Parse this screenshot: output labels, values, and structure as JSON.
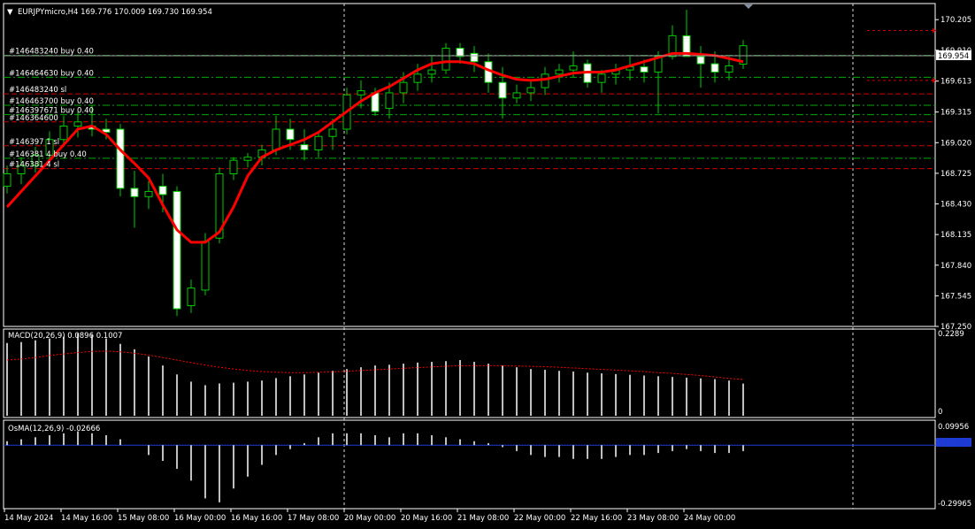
{
  "header": {
    "menu_glyph": "▼",
    "symbol_info": "EURJPYmicro,H4  169.776 170.009 169.730 169.954"
  },
  "colors": {
    "background": "#000000",
    "bull_candle": "#000000",
    "bear_candle": "#ffffff",
    "wick": "#00cc00",
    "ma_line": "#ff0000",
    "grid": "#ffffff",
    "macd_hist": "#c0c0c0",
    "signal": "#ff0000",
    "osma_zero": "#1f3bd6",
    "trade_green": "#00aa00",
    "trade_red": "#cc0000"
  },
  "price_scale": {
    "ticks": [
      "170.205",
      "169.910",
      "169.613",
      "169.315",
      "169.020",
      "168.725",
      "168.430",
      "168.135",
      "167.840",
      "167.545",
      "167.250"
    ],
    "current_price": "169.954"
  },
  "trade_labels": [
    "#146483240 buy 0.40",
    "#146464630 buy 0.40",
    "#146483240 sl",
    "#146463700 buy 0.40",
    "#146397671 buy 0.40",
    "#146364600",
    "#146397   1 sl",
    "#146381   4 buy 0.40",
    "#146381   4 sl"
  ],
  "time_axis": [
    "14 May 2024",
    "14 May 16:00",
    "15 May 08:00",
    "16 May 00:00",
    "16 May 16:00",
    "17 May 08:00",
    "20 May 00:00",
    "20 May 16:00",
    "21 May 08:00",
    "22 May 00:00",
    "22 May 16:00",
    "23 May 08:00",
    "24 May 00:00"
  ],
  "macd": {
    "title": "MACD(20,26,9) 0.0896 0.1007",
    "scale_top": "0.2289",
    "scale_zero": "0"
  },
  "osma": {
    "title": "OsMA(12,26,9) -0.02666",
    "scale_top": "0.09956",
    "scale_bottom": "-0.29965",
    "current": "-0.02666"
  },
  "chart_data": {
    "type": "candlestick",
    "symbol": "EURJPYmicro",
    "timeframe": "H4",
    "ylim": [
      167.25,
      170.36
    ],
    "candles": [
      {
        "o": 168.6,
        "h": 168.8,
        "l": 168.53,
        "c": 168.72
      },
      {
        "o": 168.72,
        "h": 168.88,
        "l": 168.62,
        "c": 168.8
      },
      {
        "o": 168.8,
        "h": 168.98,
        "l": 168.73,
        "c": 168.9
      },
      {
        "o": 168.9,
        "h": 169.13,
        "l": 168.83,
        "c": 169.05
      },
      {
        "o": 169.05,
        "h": 169.28,
        "l": 168.98,
        "c": 169.18
      },
      {
        "o": 169.18,
        "h": 169.32,
        "l": 169.07,
        "c": 169.22
      },
      {
        "o": 169.18,
        "h": 169.38,
        "l": 169.08,
        "c": 169.15
      },
      {
        "o": 169.15,
        "h": 169.25,
        "l": 169.05,
        "c": 169.12
      },
      {
        "o": 169.15,
        "h": 169.2,
        "l": 168.5,
        "c": 168.58
      },
      {
        "o": 168.58,
        "h": 168.75,
        "l": 168.2,
        "c": 168.5
      },
      {
        "o": 168.5,
        "h": 168.65,
        "l": 168.38,
        "c": 168.55
      },
      {
        "o": 168.6,
        "h": 168.72,
        "l": 168.35,
        "c": 168.52
      },
      {
        "o": 168.55,
        "h": 168.6,
        "l": 167.35,
        "c": 167.42
      },
      {
        "o": 167.45,
        "h": 167.7,
        "l": 167.38,
        "c": 167.62
      },
      {
        "o": 167.6,
        "h": 168.15,
        "l": 167.55,
        "c": 168.07
      },
      {
        "o": 168.1,
        "h": 168.78,
        "l": 168.05,
        "c": 168.72
      },
      {
        "o": 168.72,
        "h": 168.88,
        "l": 168.66,
        "c": 168.85
      },
      {
        "o": 168.85,
        "h": 168.92,
        "l": 168.78,
        "c": 168.88
      },
      {
        "o": 168.88,
        "h": 169.0,
        "l": 168.8,
        "c": 168.95
      },
      {
        "o": 168.95,
        "h": 169.28,
        "l": 168.9,
        "c": 169.15
      },
      {
        "o": 169.15,
        "h": 169.25,
        "l": 168.95,
        "c": 169.05
      },
      {
        "o": 169.0,
        "h": 169.15,
        "l": 168.85,
        "c": 168.95
      },
      {
        "o": 168.95,
        "h": 169.12,
        "l": 168.88,
        "c": 169.08
      },
      {
        "o": 169.08,
        "h": 169.25,
        "l": 168.95,
        "c": 169.15
      },
      {
        "o": 169.15,
        "h": 169.55,
        "l": 169.1,
        "c": 169.48
      },
      {
        "o": 169.48,
        "h": 169.62,
        "l": 169.35,
        "c": 169.52
      },
      {
        "o": 169.5,
        "h": 169.55,
        "l": 169.28,
        "c": 169.32
      },
      {
        "o": 169.35,
        "h": 169.6,
        "l": 169.25,
        "c": 169.5
      },
      {
        "o": 169.5,
        "h": 169.7,
        "l": 169.4,
        "c": 169.6
      },
      {
        "o": 169.6,
        "h": 169.78,
        "l": 169.52,
        "c": 169.68
      },
      {
        "o": 169.68,
        "h": 169.85,
        "l": 169.6,
        "c": 169.72
      },
      {
        "o": 169.72,
        "h": 169.98,
        "l": 169.68,
        "c": 169.93
      },
      {
        "o": 169.93,
        "h": 169.98,
        "l": 169.78,
        "c": 169.85
      },
      {
        "o": 169.88,
        "h": 169.95,
        "l": 169.7,
        "c": 169.8
      },
      {
        "o": 169.8,
        "h": 169.88,
        "l": 169.5,
        "c": 169.6
      },
      {
        "o": 169.6,
        "h": 169.75,
        "l": 169.25,
        "c": 169.45
      },
      {
        "o": 169.45,
        "h": 169.58,
        "l": 169.4,
        "c": 169.5
      },
      {
        "o": 169.5,
        "h": 169.62,
        "l": 169.42,
        "c": 169.55
      },
      {
        "o": 169.55,
        "h": 169.75,
        "l": 169.48,
        "c": 169.68
      },
      {
        "o": 169.68,
        "h": 169.78,
        "l": 169.6,
        "c": 169.72
      },
      {
        "o": 169.72,
        "h": 169.9,
        "l": 169.65,
        "c": 169.76
      },
      {
        "o": 169.78,
        "h": 169.82,
        "l": 169.55,
        "c": 169.6
      },
      {
        "o": 169.6,
        "h": 169.72,
        "l": 169.5,
        "c": 169.68
      },
      {
        "o": 169.68,
        "h": 169.78,
        "l": 169.58,
        "c": 169.72
      },
      {
        "o": 169.72,
        "h": 169.85,
        "l": 169.62,
        "c": 169.75
      },
      {
        "o": 169.75,
        "h": 169.82,
        "l": 169.6,
        "c": 169.7
      },
      {
        "o": 169.7,
        "h": 169.9,
        "l": 169.3,
        "c": 169.85
      },
      {
        "o": 169.85,
        "h": 170.15,
        "l": 169.82,
        "c": 170.05
      },
      {
        "o": 170.05,
        "h": 170.3,
        "l": 169.95,
        "c": 169.85
      },
      {
        "o": 169.85,
        "h": 169.95,
        "l": 169.55,
        "c": 169.78
      },
      {
        "o": 169.78,
        "h": 169.9,
        "l": 169.6,
        "c": 169.7
      },
      {
        "o": 169.7,
        "h": 169.85,
        "l": 169.62,
        "c": 169.76
      },
      {
        "o": 169.776,
        "h": 170.009,
        "l": 169.73,
        "c": 169.954
      }
    ],
    "ma": [
      168.4,
      168.55,
      168.7,
      168.85,
      169.0,
      169.15,
      169.18,
      169.1,
      168.95,
      168.82,
      168.68,
      168.42,
      168.18,
      168.06,
      168.06,
      168.16,
      168.4,
      168.7,
      168.88,
      168.95,
      169.0,
      169.05,
      169.12,
      169.22,
      169.32,
      169.42,
      169.5,
      169.56,
      169.64,
      169.72,
      169.78,
      169.8,
      169.8,
      169.78,
      169.72,
      169.67,
      169.63,
      169.62,
      169.63,
      169.66,
      169.69,
      169.7,
      169.7,
      169.72,
      169.76,
      169.8,
      169.84,
      169.88,
      169.88,
      169.87,
      169.86,
      169.83,
      169.8
    ],
    "macd_values": [
      0.2025,
      0.205,
      0.21,
      0.215,
      0.22,
      0.2289,
      0.225,
      0.215,
      0.2,
      0.185,
      0.165,
      0.14,
      0.115,
      0.095,
      0.085,
      0.09,
      0.092,
      0.095,
      0.098,
      0.105,
      0.11,
      0.115,
      0.12,
      0.125,
      0.13,
      0.135,
      0.14,
      0.142,
      0.145,
      0.148,
      0.15,
      0.152,
      0.155,
      0.15,
      0.145,
      0.14,
      0.135,
      0.13,
      0.128,
      0.125,
      0.123,
      0.12,
      0.118,
      0.116,
      0.114,
      0.112,
      0.11,
      0.108,
      0.106,
      0.104,
      0.102,
      0.098,
      0.0896
    ],
    "signal_values": [
      0.155,
      0.158,
      0.162,
      0.168,
      0.172,
      0.176,
      0.179,
      0.18,
      0.178,
      0.174,
      0.169,
      0.162,
      0.155,
      0.148,
      0.141,
      0.135,
      0.13,
      0.126,
      0.123,
      0.121,
      0.12,
      0.12,
      0.121,
      0.122,
      0.124,
      0.126,
      0.128,
      0.13,
      0.132,
      0.134,
      0.136,
      0.138,
      0.139,
      0.1395,
      0.1395,
      0.139,
      0.1385,
      0.1375,
      0.1365,
      0.135,
      0.133,
      0.131,
      0.129,
      0.127,
      0.125,
      0.123,
      0.12,
      0.118,
      0.115,
      0.112,
      0.108,
      0.104,
      0.1007
    ],
    "osma_values": [
      0.02,
      0.03,
      0.04,
      0.05,
      0.06,
      0.07,
      0.06,
      0.05,
      0.03,
      0.0,
      -0.05,
      -0.08,
      -0.12,
      -0.18,
      -0.27,
      -0.29,
      -0.22,
      -0.16,
      -0.1,
      -0.05,
      -0.02,
      0.01,
      0.04,
      0.06,
      0.06,
      0.06,
      0.05,
      0.04,
      0.06,
      0.06,
      0.05,
      0.04,
      0.03,
      0.02,
      0.01,
      -0.01,
      -0.03,
      -0.05,
      -0.06,
      -0.06,
      -0.07,
      -0.07,
      -0.07,
      -0.06,
      -0.05,
      -0.05,
      -0.04,
      -0.03,
      -0.02,
      -0.03,
      -0.04,
      -0.04,
      -0.03
    ],
    "trade_lines": [
      {
        "price": 169.86,
        "kind": "entry",
        "color": "#00aa00"
      },
      {
        "price": 169.65,
        "kind": "entry",
        "color": "#00aa00"
      },
      {
        "price": 169.49,
        "kind": "sl",
        "color": "#cc0000"
      },
      {
        "price": 169.38,
        "kind": "entry",
        "color": "#00aa00"
      },
      {
        "price": 169.29,
        "kind": "entry",
        "color": "#00aa00"
      },
      {
        "price": 169.22,
        "kind": "sl",
        "color": "#cc0000"
      },
      {
        "price": 168.99,
        "kind": "sl",
        "color": "#cc0000"
      },
      {
        "price": 168.87,
        "kind": "entry",
        "color": "#00aa00"
      },
      {
        "price": 168.77,
        "kind": "sl",
        "color": "#cc0000"
      }
    ],
    "right_markers": [
      170.1,
      169.62
    ]
  }
}
